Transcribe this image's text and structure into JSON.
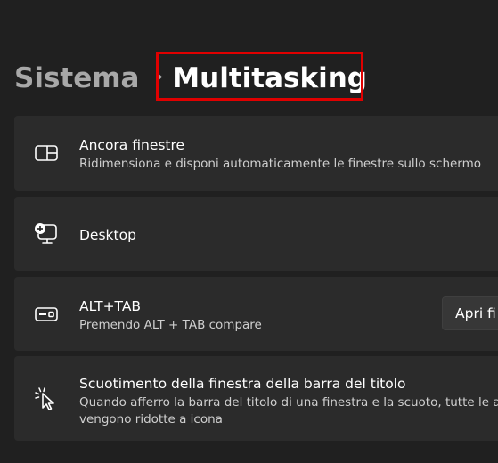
{
  "breadcrumb": {
    "parent": "Sistema",
    "separator": "›",
    "current": "Multitasking"
  },
  "cards": [
    {
      "icon": "snap-windows-icon",
      "title": "Ancora finestre",
      "description": "Ridimensiona e disponi automaticamente le finestre sullo schermo"
    },
    {
      "icon": "desktop-add-icon",
      "title": "Desktop"
    },
    {
      "icon": "alt-tab-icon",
      "title": "ALT+TAB",
      "description": "Premendo ALT + TAB compare",
      "button_label": "Apri fi"
    },
    {
      "icon": "shake-cursor-icon",
      "title": "Scuotimento della finestra della barra del titolo",
      "description_line1": "Quando afferro la barra del titolo di una finestra e la scuoto, tutte le al",
      "description_line2": "vengono ridotte a icona"
    }
  ],
  "colors": {
    "background": "#202020",
    "card": "#2b2b2b",
    "highlight": "#e00000"
  }
}
